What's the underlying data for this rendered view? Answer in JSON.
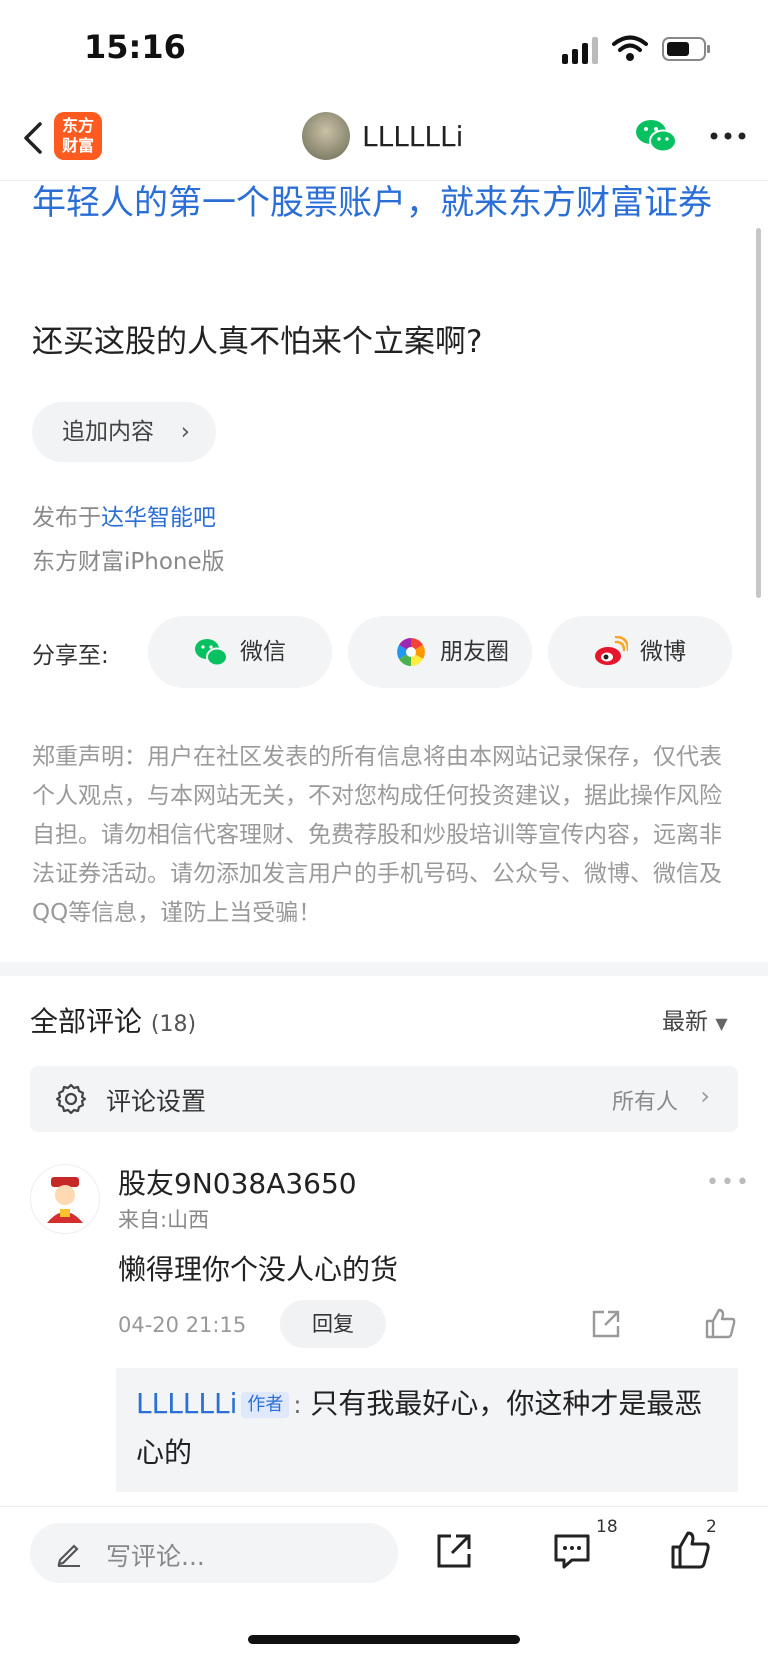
{
  "status_bar": {
    "time": "15:16"
  },
  "nav": {
    "logo_line1": "东方",
    "logo_line2": "财富",
    "username": "LLLLLLi"
  },
  "post": {
    "ad_text": "年轻人的第一个股票账户，就来东方财富证券",
    "body": "还买这股的人真不怕来个立案啊?",
    "append_label": "追加内容",
    "published_prefix": "发布于",
    "forum": "达华智能吧",
    "client": "东方财富iPhone版"
  },
  "share": {
    "label": "分享至:",
    "wechat": "微信",
    "moments": "朋友圈",
    "weibo": "微博"
  },
  "disclaimer": "郑重声明：用户在社区发表的所有信息将由本网站记录保存，仅代表个人观点，与本网站无关，不对您构成任何投资建议，据此操作风险自担。请勿相信代客理财、免费荐股和炒股培训等宣传内容，远离非法证券活动。请勿添加发言用户的手机号码、公众号、微博、微信及QQ等信息，谨防上当受骗！",
  "comments": {
    "title": "全部评论",
    "count": "(18)",
    "sort": "最新",
    "settings_label": "评论设置",
    "settings_value": "所有人",
    "items": [
      {
        "user": "股友9N038A3650",
        "from": "来自:山西",
        "text": "懒得理你个没人心的货",
        "time": "04-20 21:15",
        "reply_label": "回复",
        "reply": {
          "user": "LLLLLLi",
          "tag": "作者",
          "sep": ":",
          "text": "只有我最好心，你这种才是最恶心的"
        }
      }
    ]
  },
  "bottom_bar": {
    "input_placeholder": "写评论...",
    "comment_count": "18",
    "like_count": "2"
  },
  "colors": {
    "link": "#2b6fd6",
    "brand": "#ff5a1f",
    "wechat": "#07c160"
  }
}
